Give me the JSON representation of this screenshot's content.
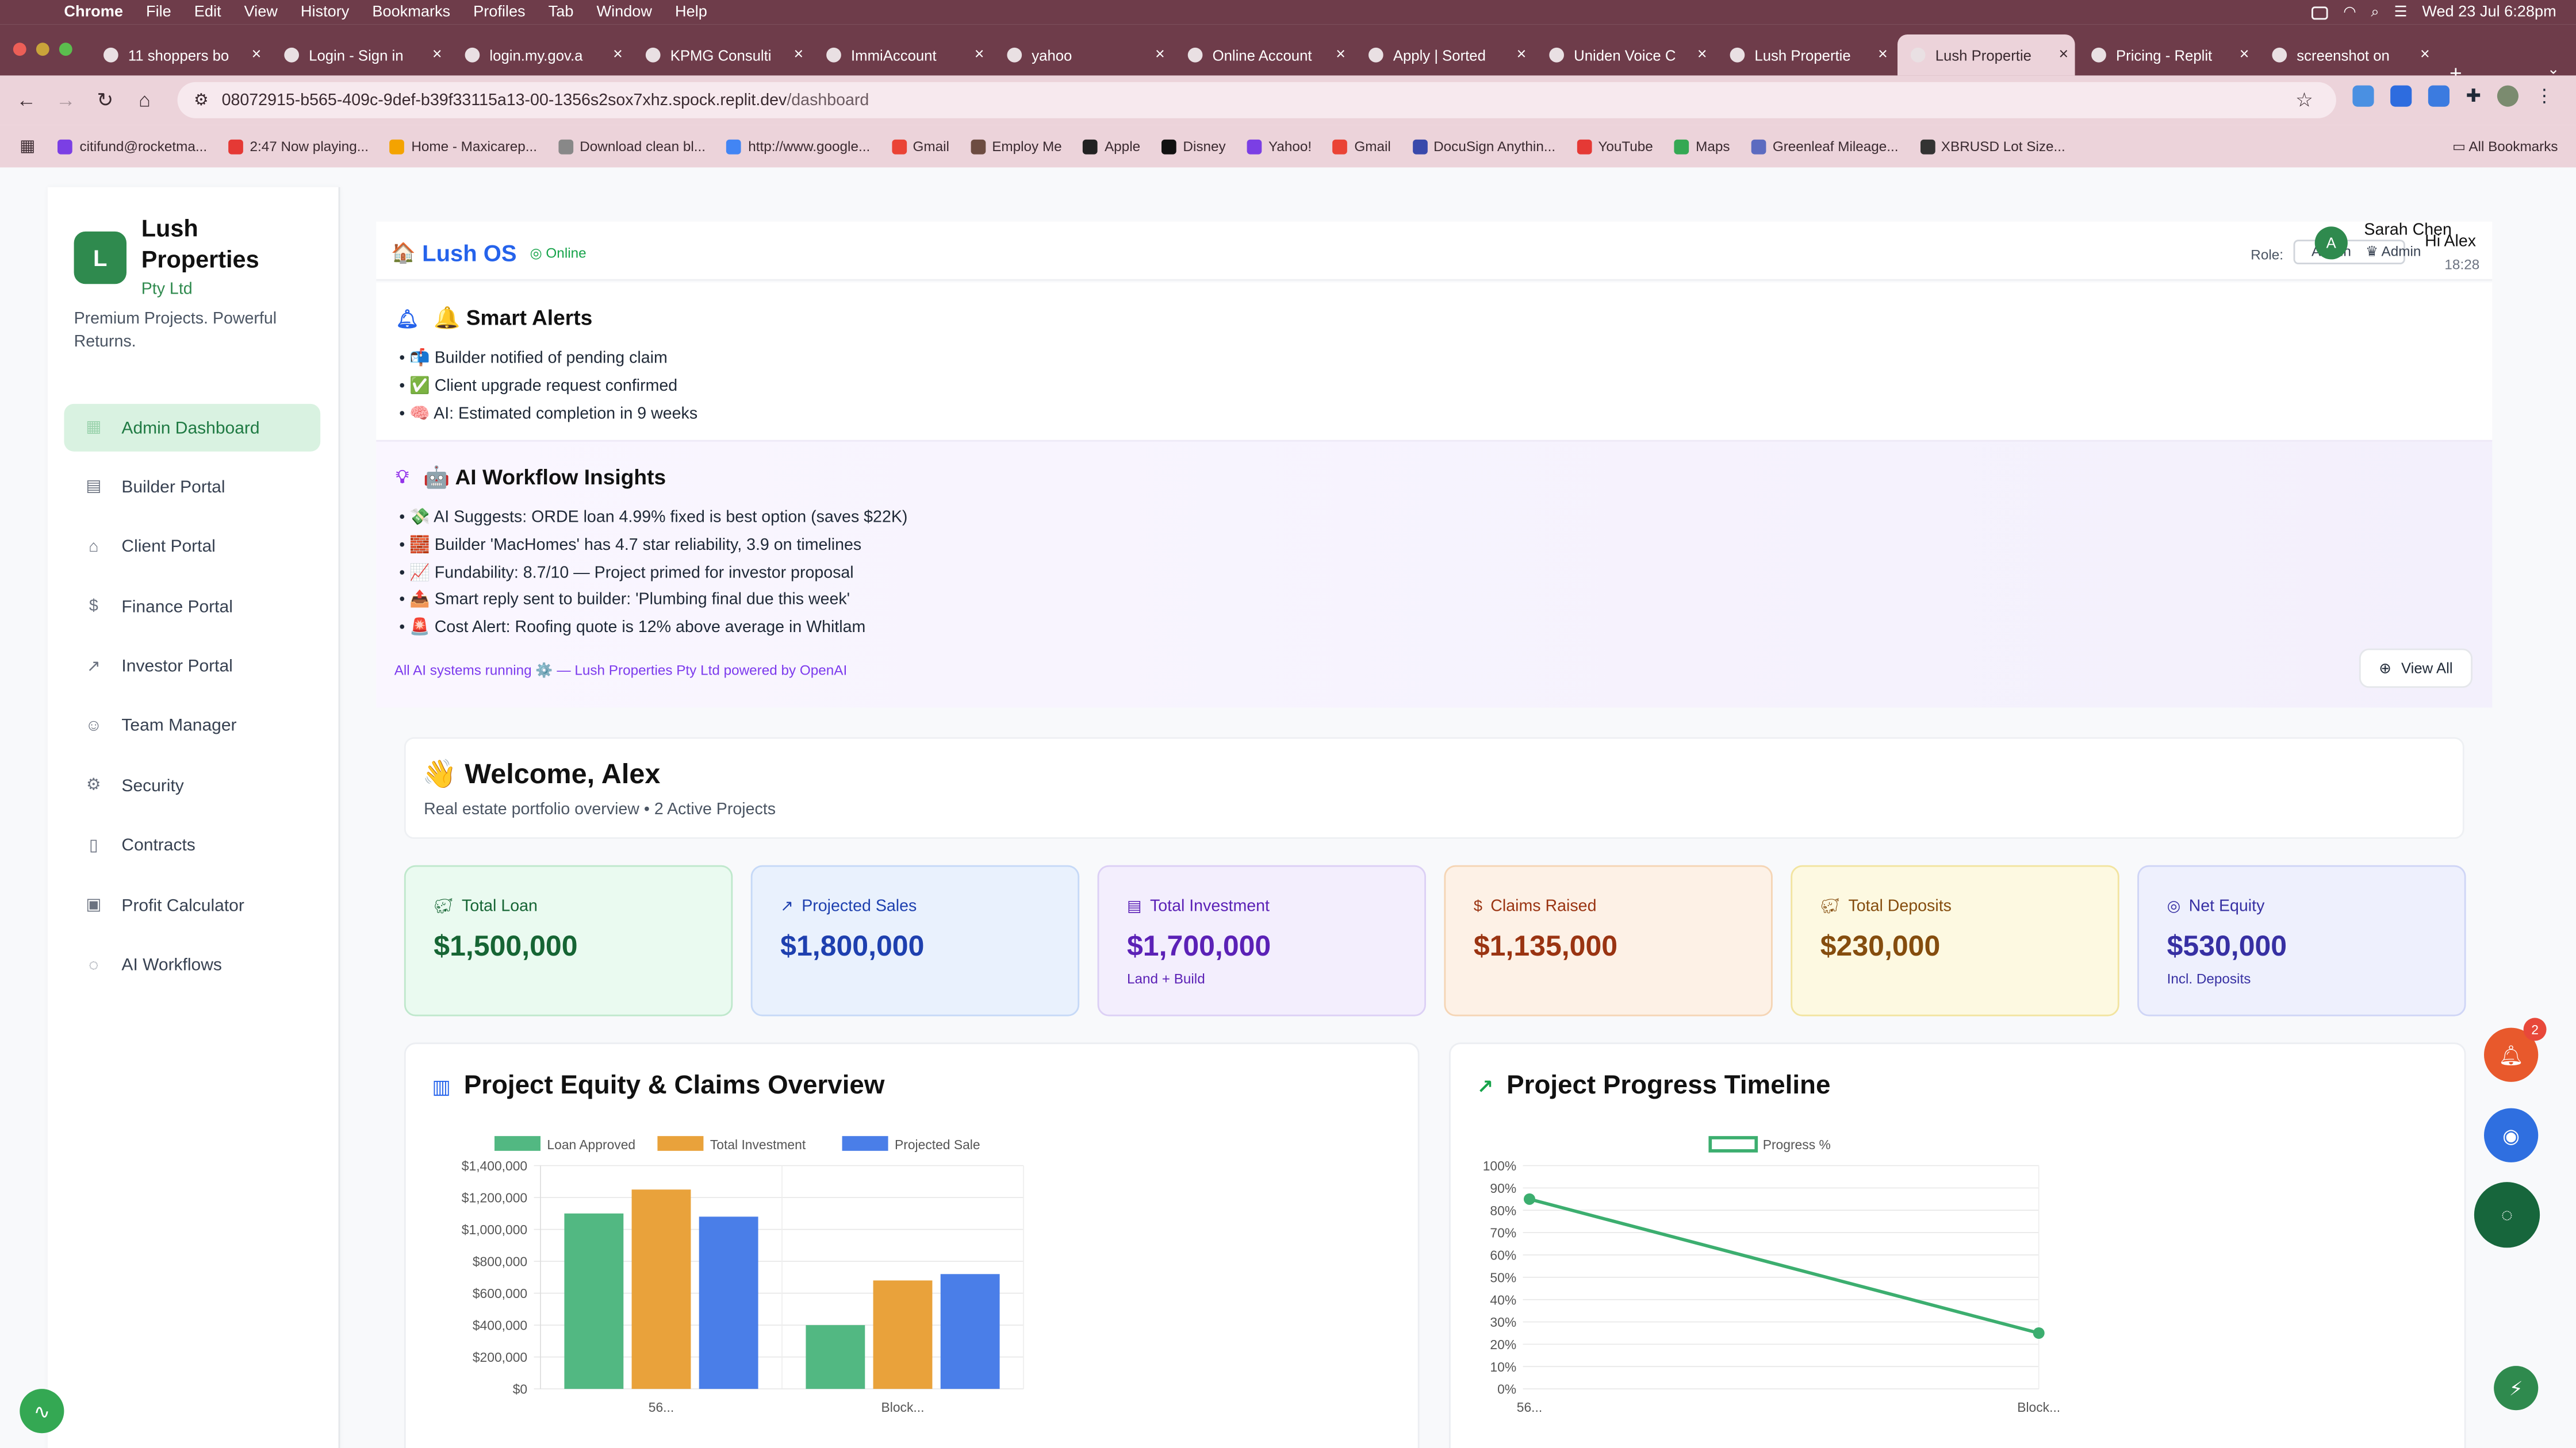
{
  "menubar": {
    "items": [
      "Chrome",
      "File",
      "Edit",
      "View",
      "History",
      "Bookmarks",
      "Profiles",
      "Tab",
      "Window",
      "Help"
    ],
    "datetime": "Wed 23 Jul  6:28pm"
  },
  "tabs": [
    {
      "label": "11 shoppers bo"
    },
    {
      "label": "Login - Sign in"
    },
    {
      "label": "login.my.gov.a"
    },
    {
      "label": "KPMG Consulti"
    },
    {
      "label": "ImmiAccount"
    },
    {
      "label": "yahoo"
    },
    {
      "label": "Online Account"
    },
    {
      "label": "Apply | Sorted"
    },
    {
      "label": "Uniden Voice C"
    },
    {
      "label": "Lush Propertie"
    },
    {
      "label": "Lush Propertie"
    },
    {
      "label": "Pricing - Replit"
    },
    {
      "label": "screenshot on"
    }
  ],
  "address": {
    "host": "08072915-b565-409c-9def-b39f33115a13-00-1356s2sox7xhz.spock.replit.dev",
    "path": "/dashboard"
  },
  "bookmarks": {
    "items": [
      "citifund@rocketma...",
      "2:47 Now playing...",
      "Home - Maxicarep...",
      "Download clean bl...",
      "http://www.google...",
      "Gmail",
      "Employ Me",
      "Apple",
      "Disney",
      "Yahoo!",
      "Gmail",
      "DocuSign Anythin...",
      "YouTube",
      "Maps",
      "Greenleaf Mileage...",
      "XBRUSD Lot Size..."
    ],
    "all_label": "All Bookmarks"
  },
  "sidebar": {
    "brand_initial": "L",
    "brand_name": "Lush Properties",
    "brand_sub": "Pty Ltd",
    "tagline": "Premium Projects. Powerful Returns.",
    "items": [
      {
        "label": "Admin Dashboard",
        "icon": "grid-icon"
      },
      {
        "label": "Builder Portal",
        "icon": "building-icon"
      },
      {
        "label": "Client Portal",
        "icon": "home-icon"
      },
      {
        "label": "Finance Portal",
        "icon": "dollar-icon"
      },
      {
        "label": "Investor Portal",
        "icon": "trending-up-icon"
      },
      {
        "label": "Team Manager",
        "icon": "users-icon"
      },
      {
        "label": "Security",
        "icon": "gear-icon"
      },
      {
        "label": "Contracts",
        "icon": "document-icon"
      },
      {
        "label": "Profit Calculator",
        "icon": "calculator-icon"
      },
      {
        "label": "AI Workflows",
        "icon": "chat-icon"
      }
    ]
  },
  "header": {
    "app_title": "Lush OS",
    "status": "Online",
    "role_label": "Role:",
    "role_value": "Admin",
    "role_display": "Admin",
    "avatar_initial": "A",
    "user_name": "Sarah Chen",
    "greeting": "Hi Alex",
    "time": "18:28"
  },
  "smart_alerts": {
    "title": "🔔 Smart Alerts",
    "items": [
      "• 📬 Builder notified of pending claim",
      "• ✅ Client upgrade request confirmed",
      "• 🧠 AI: Estimated completion in 9 weeks"
    ]
  },
  "ai_insights": {
    "title": "🤖 AI Workflow Insights",
    "items": [
      "• 💸 AI Suggests: ORDE loan 4.99% fixed is best option (saves $22K)",
      "• 🧱 Builder 'MacHomes' has 4.7 star reliability, 3.9 on timelines",
      "• 📈 Fundability: 8.7/10 — Project primed for investor proposal",
      "• 📤 Smart reply sent to builder: 'Plumbing final due this week'",
      "• 🚨 Cost Alert: Roofing quote is 12% above average in Whitlam"
    ],
    "powered_by": "All AI systems running ⚙️ — Lush Properties Pty Ltd powered by OpenAI",
    "view_all": "View All"
  },
  "welcome": {
    "title": "👋 Welcome, Alex",
    "subtitle": "Real estate portfolio overview • 2 Active Projects"
  },
  "stats": [
    {
      "label": "Total Loan",
      "value": "$1,500,000",
      "note": "",
      "icon": "piggy-icon",
      "color": "#166534",
      "bg": "#eafaf0",
      "border": "#bfe8cc"
    },
    {
      "label": "Projected Sales",
      "value": "$1,800,000",
      "note": "",
      "icon": "trending-up-icon",
      "color": "#1e40af",
      "bg": "#e9f1fd",
      "border": "#c6d9f7"
    },
    {
      "label": "Total Investment",
      "value": "$1,700,000",
      "note": "Land + Build",
      "icon": "building-icon",
      "color": "#5b21b6",
      "bg": "#f3eefd",
      "border": "#dcd0f5"
    },
    {
      "label": "Claims Raised",
      "value": "$1,135,000",
      "note": "",
      "icon": "dollar-icon",
      "color": "#9a3412",
      "bg": "#fdf1e6",
      "border": "#f5d5b5"
    },
    {
      "label": "Total Deposits",
      "value": "$230,000",
      "note": "",
      "icon": "piggy-icon",
      "color": "#854d0e",
      "bg": "#fdf9e1",
      "border": "#f2e4a0"
    },
    {
      "label": "Net Equity",
      "value": "$530,000",
      "note": "Incl. Deposits",
      "icon": "target-icon",
      "color": "#3730a3",
      "bg": "#eef0fd",
      "border": "#cfd5f6"
    }
  ],
  "panels": {
    "equity_title": "Project Equity & Claims Overview",
    "progress_title": "Project Progress Timeline"
  },
  "chart_data": [
    {
      "type": "bar",
      "categories": [
        "56...",
        "Block..."
      ],
      "series": [
        {
          "name": "Loan Approved",
          "values": [
            1100000,
            400000
          ],
          "color": "#52b882"
        },
        {
          "name": "Total Investment",
          "values": [
            1250000,
            680000
          ],
          "color": "#e9a23b"
        },
        {
          "name": "Projected Sale",
          "values": [
            1080000,
            720000
          ],
          "color": "#4a7ee8"
        }
      ],
      "ylim": [
        0,
        1400000
      ],
      "yticks": [
        "$0",
        "$200,000",
        "$400,000",
        "$600,000",
        "$800,000",
        "$1,000,000",
        "$1,200,000",
        "$1,400,000"
      ],
      "legend": "top"
    },
    {
      "type": "line",
      "categories": [
        "56...",
        "Block..."
      ],
      "series": [
        {
          "name": "Progress %",
          "values": [
            85,
            25
          ],
          "color": "#3cae6f"
        }
      ],
      "ylim": [
        0,
        100
      ],
      "yticks": [
        "0%",
        "10%",
        "20%",
        "30%",
        "40%",
        "50%",
        "60%",
        "70%",
        "80%",
        "90%",
        "100%"
      ],
      "legend": "top"
    }
  ],
  "floating": {
    "notification_count": "2"
  }
}
